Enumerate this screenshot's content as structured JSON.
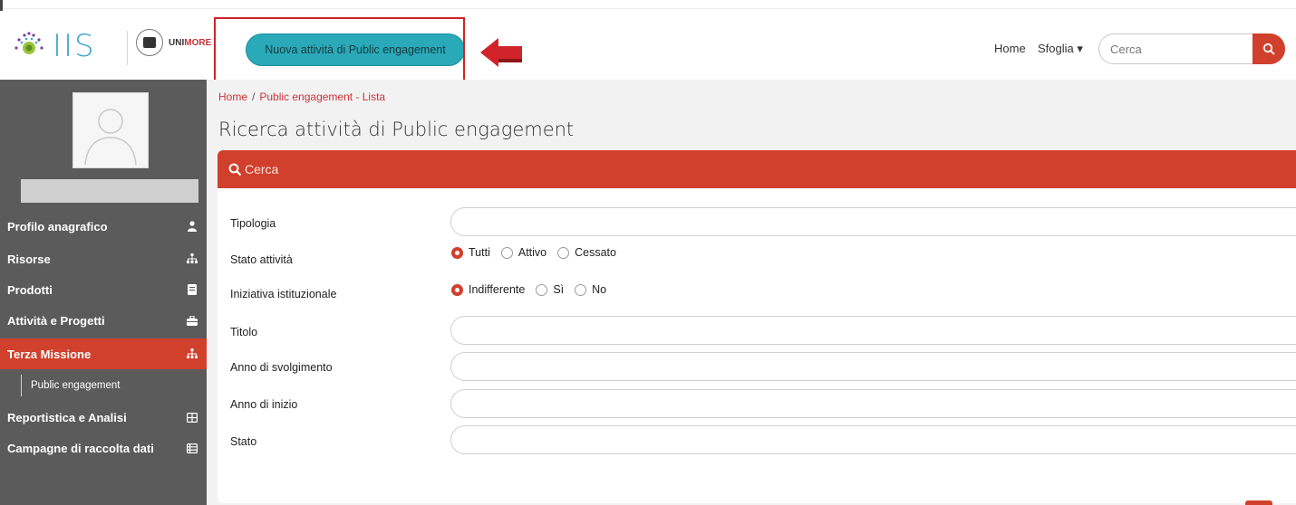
{
  "header": {
    "logo_text": "IIS",
    "university": {
      "name_part1": "UNI",
      "name_part2": "MORE"
    },
    "new_activity_button": "Nuova attività di Public engagement",
    "nav_home": "Home",
    "nav_browse": "Sfoglia ▾",
    "search_value": "Cerca"
  },
  "sidebar": {
    "items": [
      {
        "label": "Profilo anagrafico",
        "icon": "user-icon"
      },
      {
        "label": "Risorse",
        "icon": "sitemap-icon"
      },
      {
        "label": "Prodotti",
        "icon": "book-icon"
      },
      {
        "label": "Attività e Progetti",
        "icon": "briefcase-icon"
      },
      {
        "label": "Terza Missione",
        "icon": "sitemap-icon",
        "active": true
      },
      {
        "label": "Reportistica e Analisi",
        "icon": "table-icon"
      },
      {
        "label": "Campagne di raccolta dati",
        "icon": "list-icon"
      }
    ],
    "sub_item": "Public engagement"
  },
  "main": {
    "breadcrumb": {
      "home": "Home",
      "sep": "/",
      "current": "Public engagement - Lista"
    },
    "title": "Ricerca attività di Public engagement",
    "panel_title": "Cerca",
    "fields": {
      "tipologia": "Tipologia",
      "stato_attivita": "Stato attività",
      "iniziativa": "Iniziativa istituzionale",
      "titolo": "Titolo",
      "anno_svolgimento": "Anno di svolgimento",
      "anno_inizio": "Anno di inizio",
      "stato": "Stato"
    },
    "stato_options": [
      "Tutti",
      "Attivo",
      "Cessato"
    ],
    "stato_selected": "Tutti",
    "iniziativa_options": [
      "Indifferente",
      "Sì",
      "No"
    ],
    "iniziativa_selected": "Indifferente"
  },
  "colors": {
    "accent": "#d0402c",
    "teal": "#2aa9b8",
    "sidebar": "#5b5b5b"
  }
}
